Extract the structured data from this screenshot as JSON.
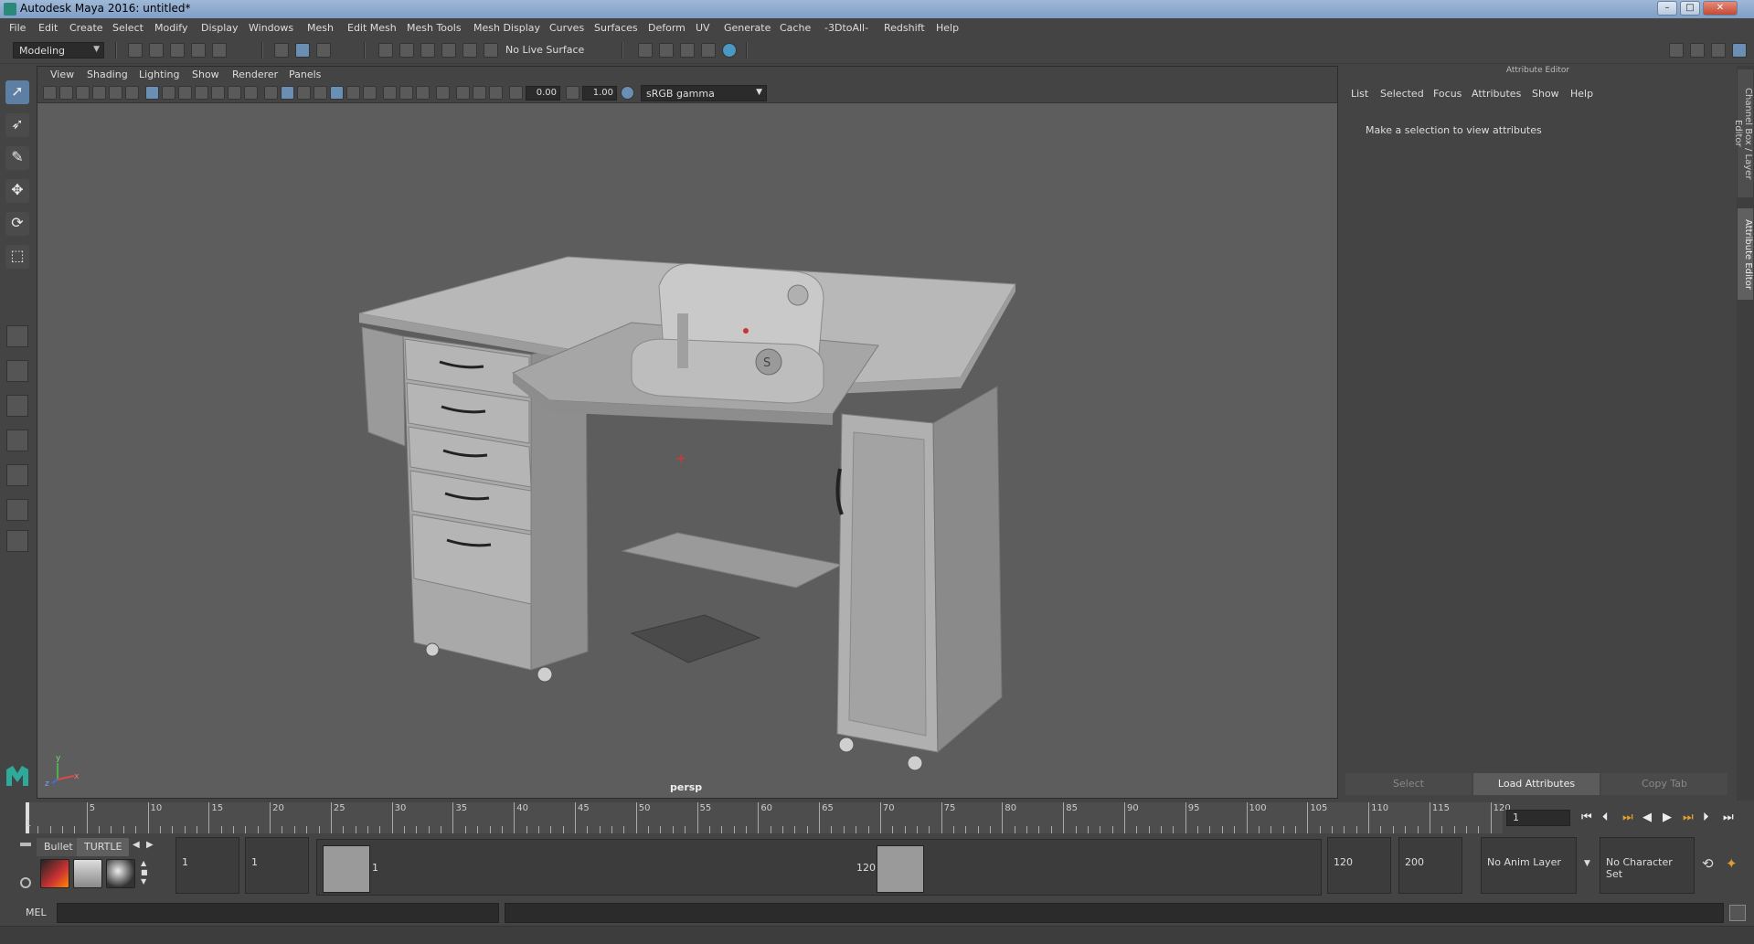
{
  "window": {
    "title": "Autodesk Maya 2016: untitled*",
    "minimize": "–",
    "maximize": "□",
    "close": "✕"
  },
  "menubar": [
    "File",
    "Edit",
    "Create",
    "Select",
    "Modify",
    "Display",
    "Windows",
    "Mesh",
    "Edit Mesh",
    "Mesh Tools",
    "Mesh Display",
    "Curves",
    "Surfaces",
    "Deform",
    "UV",
    "Generate",
    "Cache",
    "-3DtoAll-",
    "Redshift",
    "Help"
  ],
  "statusline": {
    "mode": "Modeling",
    "live_surface": "No Live Surface"
  },
  "viewport": {
    "menu": [
      "View",
      "Shading",
      "Lighting",
      "Show",
      "Renderer",
      "Panels"
    ],
    "exposure": "0.00",
    "gamma": "1.00",
    "color_management": "sRGB gamma",
    "camera_label": "persp",
    "axis_y": "y",
    "axis_x": "x",
    "axis_z": "z"
  },
  "attribute_editor": {
    "title": "Attribute Editor",
    "menu": [
      "List",
      "Selected",
      "Focus",
      "Attributes",
      "Show",
      "Help"
    ],
    "message": "Make a selection to view attributes",
    "buttons": [
      "Select",
      "Load Attributes",
      "Copy Tab"
    ]
  },
  "side_tabs": [
    "Channel Box / Layer Editor",
    "Attribute Editor"
  ],
  "timeslider": {
    "ticks": [
      "5",
      "10",
      "15",
      "20",
      "25",
      "30",
      "35",
      "40",
      "45",
      "50",
      "55",
      "60",
      "65",
      "70",
      "75",
      "80",
      "85",
      "90",
      "95",
      "100",
      "105",
      "110",
      "115",
      "120"
    ],
    "current_frame_marker": "1",
    "current_frame": "1"
  },
  "range": {
    "start": "1",
    "playback_start": "1",
    "handle_start": "1",
    "handle_end": "120",
    "playback_end": "120",
    "end": "200",
    "anim_layer": "No Anim Layer",
    "character_set": "No Character Set"
  },
  "shelf": {
    "tabs": [
      "Bullet",
      "TURTLE"
    ]
  },
  "cmdline": {
    "label": "MEL"
  },
  "colors": {
    "viewport_bg": "#5d5d5d",
    "ui_bg": "#444444",
    "accent": "#5d7fa3"
  }
}
